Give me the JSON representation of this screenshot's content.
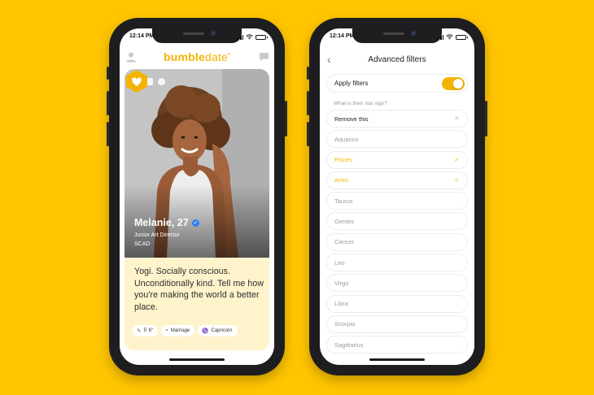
{
  "colors": {
    "background": "#FFC500",
    "accent": "#F3B400",
    "verified": "#2f7cf6"
  },
  "left_phone": {
    "status": {
      "time": "12:14 PM"
    },
    "topbar": {
      "logo_word": "bumble",
      "logo_suffix": "date",
      "left_icon": "profile-icon",
      "right_icon": "chat-icon"
    },
    "profile": {
      "name_age": "Melanie, 27",
      "verified_icon": "verified-check-icon",
      "job": "Junior Art Director",
      "school": "SCAD",
      "bio": "Yogi. Socially conscious. Unconditionally kind. Tell me how you're making the world a better place.",
      "tags": [
        {
          "icon": "ruler-icon",
          "label": "5' 6\""
        },
        {
          "icon": "search-icon",
          "label": "Marriage"
        },
        {
          "icon": "zodiac-icon",
          "label": "Capricorn"
        }
      ],
      "superswipe_icon": "heart-hexagon-icon"
    }
  },
  "right_phone": {
    "status": {
      "time": "12:14 PM"
    },
    "title": "Advanced filters",
    "apply_filters": {
      "label": "Apply filters",
      "enabled": true
    },
    "question": "What is their star sign?",
    "remove_label": "Remove this",
    "signs": [
      {
        "label": "Aquarius",
        "selected": false
      },
      {
        "label": "Pisces",
        "selected": true
      },
      {
        "label": "Aries",
        "selected": true
      },
      {
        "label": "Taurus",
        "selected": false
      },
      {
        "label": "Gemini",
        "selected": false
      },
      {
        "label": "Cancer",
        "selected": false
      },
      {
        "label": "Leo",
        "selected": false
      },
      {
        "label": "Virgo",
        "selected": false
      },
      {
        "label": "Libra",
        "selected": false
      },
      {
        "label": "Scorpio",
        "selected": false
      },
      {
        "label": "Sagittarius",
        "selected": false
      }
    ]
  }
}
